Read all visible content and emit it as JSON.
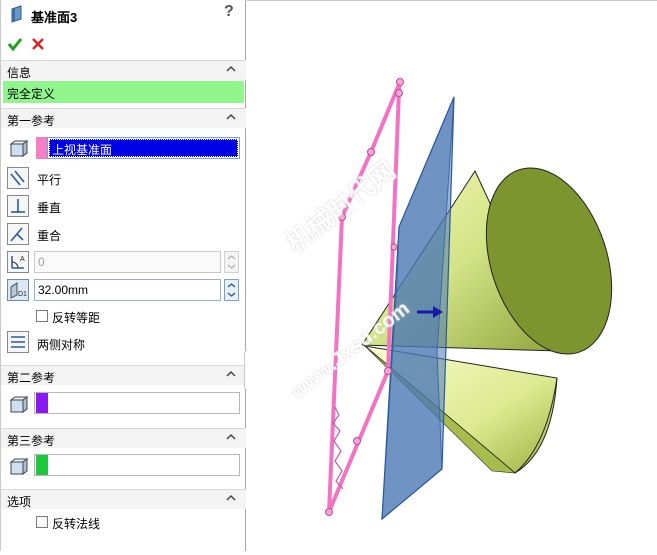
{
  "header": {
    "title": "基准面3",
    "help": "?"
  },
  "actions": {
    "ok_icon": "check-icon",
    "cancel_icon": "close-icon"
  },
  "info": {
    "heading": "信息",
    "status": "完全定义",
    "status_color": "#90f58c"
  },
  "first_ref": {
    "heading": "第一参考",
    "selection": "上视基准面",
    "selection_bg": "#0000e6",
    "swatch_color": "#f47fc4",
    "parallel": "平行",
    "perpendicular": "垂直",
    "coincident": "重合",
    "angle_value": "0",
    "distance_value": "32.00mm",
    "flip_offset": "反转等距",
    "mid_plane": "两侧对称"
  },
  "second_ref": {
    "heading": "第二参考",
    "swatch_color": "#8a18f0"
  },
  "third_ref": {
    "heading": "第三参考",
    "swatch_color": "#1ec83c"
  },
  "options": {
    "heading": "选项",
    "flip_normal": "反转法线"
  },
  "watermark": {
    "line1": "机械时代网",
    "line2": "www.Jxsd.com"
  }
}
